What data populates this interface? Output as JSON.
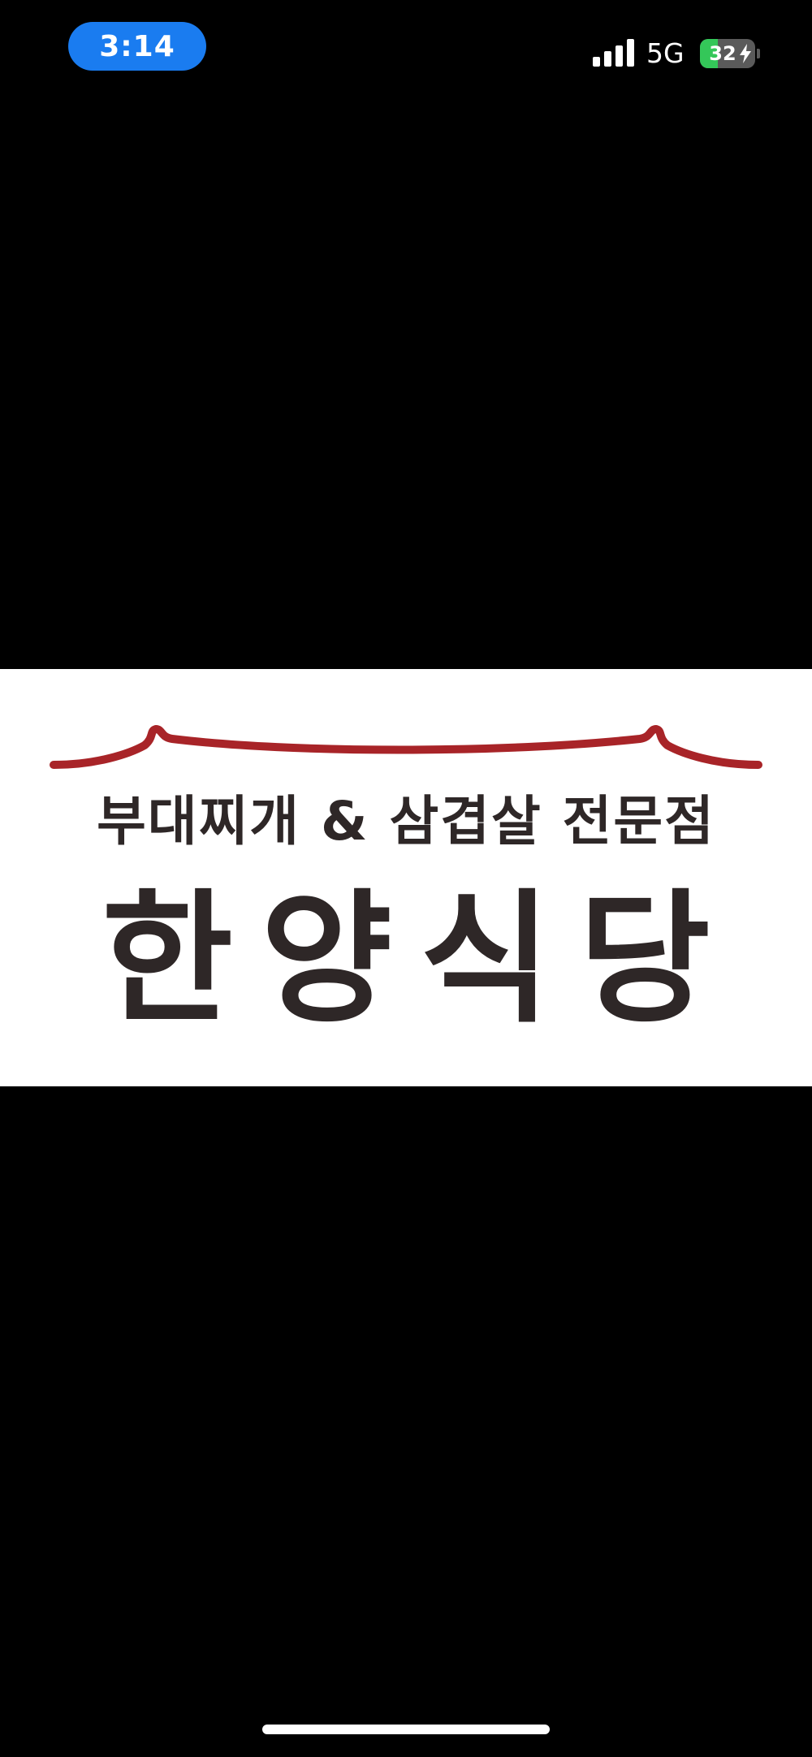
{
  "status_bar": {
    "time": "3:14",
    "network": "5G",
    "battery_percent": 32,
    "battery_label": "32",
    "charging": true,
    "signal_bars": 4,
    "icons": [
      "signal-icon",
      "battery-icon",
      "bolt-icon"
    ],
    "time_pill_color": "#1a7cf0",
    "battery_fill_color": "#34c759"
  },
  "logo": {
    "tagline": "부대찌개 & 삼겹살 전문점",
    "name": "한양식당",
    "text_color": "#2e2727",
    "roof_color": "#a82428",
    "icon": "roof-icon"
  },
  "home_indicator": {
    "icon": "home-indicator"
  }
}
